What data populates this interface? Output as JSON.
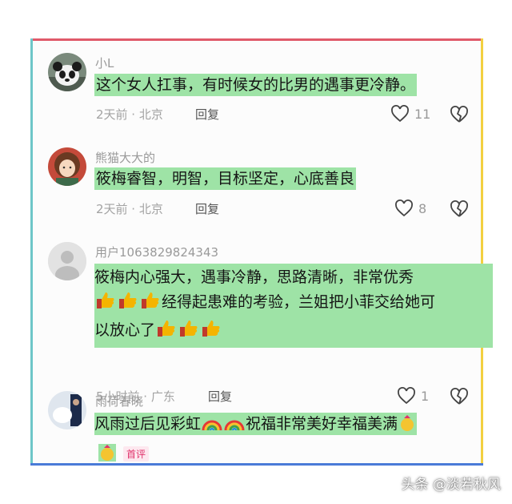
{
  "colors": {
    "highlight": "#9ee3a6",
    "frame_top": "#e05a6a",
    "frame_left": "#6ec6c8",
    "frame_right": "#f2d040",
    "frame_bottom": "#4a7bd8"
  },
  "comments": [
    {
      "user": "小L",
      "text": "这个女人扛事，有时候女的比男的遇事更冷静。",
      "meta": "2天前 · 北京",
      "reply": "回复",
      "likes": "11",
      "avatar_icon": "panda-avatar-icon"
    },
    {
      "user": "熊猫大大的",
      "text": "筱梅睿智，明智，目标坚定，心底善良",
      "meta": "2天前 · 北京",
      "reply": "回复",
      "likes": "8",
      "avatar_icon": "girl-avatar-icon"
    },
    {
      "user": "用户1063829824343",
      "text_line1": "筱梅内心强大，遇事冷静，思路清晰，非常优秀",
      "text_line2": "经得起患难的考验，兰姐把小菲交给她可",
      "text_line3": "以放心了",
      "meta": "5小时前 · 广东",
      "reply": "回复",
      "likes": "1",
      "avatar_icon": "default-user-avatar-icon"
    },
    {
      "user": "雨荷春晓",
      "text_part1": "风雨过后见彩虹",
      "text_part2": "祝福非常美好幸福美满",
      "badge": "首评",
      "avatar_icon": "photo-avatar-icon"
    }
  ],
  "watermark": "头条 @淡若秋风"
}
